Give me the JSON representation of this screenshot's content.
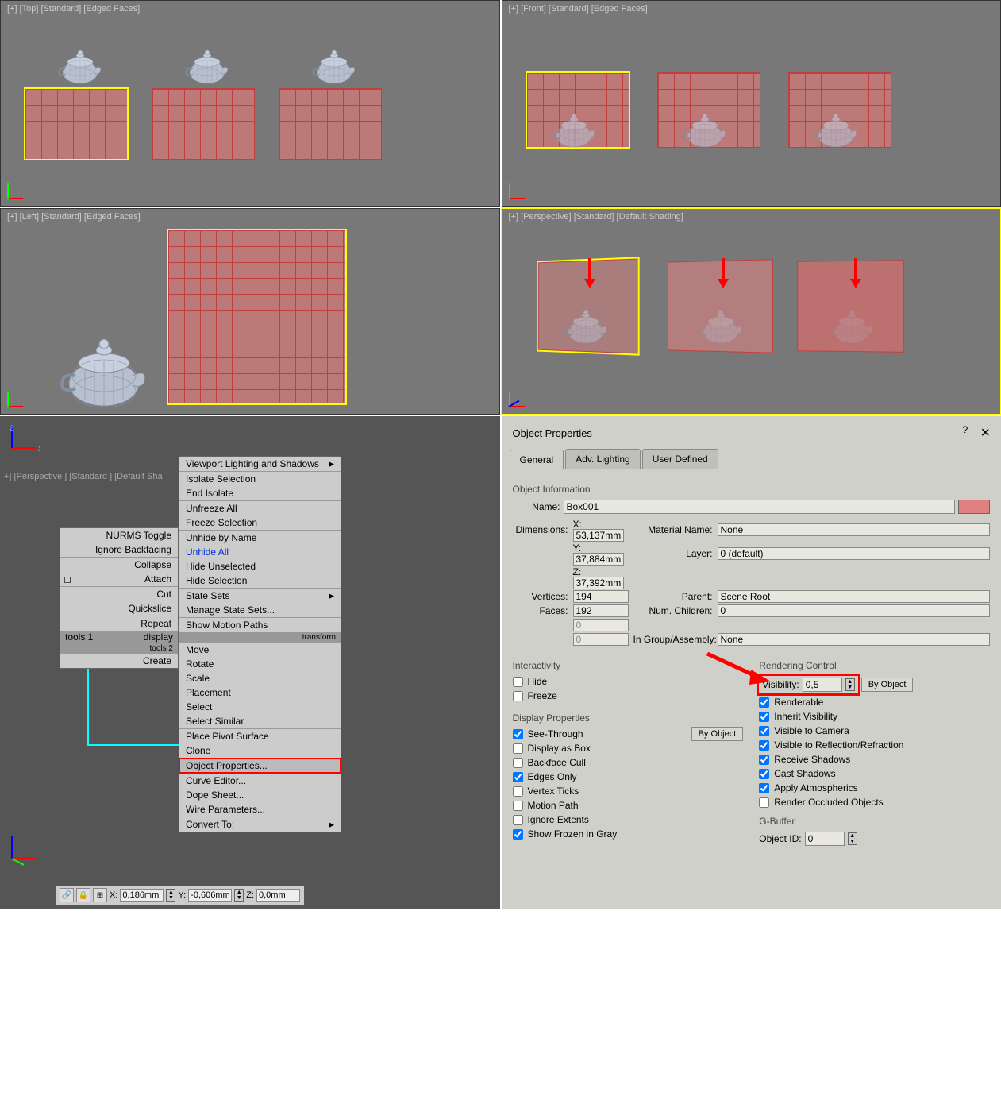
{
  "viewports": {
    "top": {
      "label": "[+] [Top] [Standard] [Edged Faces]"
    },
    "front": {
      "label": "[+] [Front] [Standard] [Edged Faces]"
    },
    "left": {
      "label": "[+] [Left] [Standard] [Edged Faces]"
    },
    "persp": {
      "label": "[+] [Perspective] [Standard] [Default Shading]"
    }
  },
  "context_bg_label": "+] [Perspective ] [Standard ] [Default Sha",
  "menu_cols": {
    "col1": {
      "items": [
        "NURMS Toggle",
        "Ignore Backfacing",
        "Collapse",
        "Attach",
        "Cut",
        "Quickslice",
        "Repeat"
      ],
      "footer_left": "tools 1",
      "sub_footer_left": "tools 2",
      "sub_item": "Create",
      "footer_right": "display"
    },
    "col2": {
      "items": [
        "Viewport Lighting and Shadows",
        "Isolate Selection",
        "End Isolate",
        "Unfreeze All",
        "Freeze Selection",
        "Unhide by Name",
        "Unhide All",
        "Hide Unselected",
        "Hide Selection",
        "State Sets",
        "Manage State Sets...",
        "Show Motion Paths"
      ],
      "blue_idx": 6,
      "footer_right": "transform",
      "transform_items": [
        "Move",
        "Rotate",
        "Scale",
        "Placement",
        "Select",
        "Select Similar",
        "Place Pivot Surface",
        "Clone",
        "Object Properties...",
        "Curve Editor...",
        "Dope Sheet...",
        "Wire Parameters...",
        "Convert To:"
      ],
      "highlighted_idx": 8
    }
  },
  "coords": {
    "x_label": "X:",
    "x": "0,186mm",
    "y_label": "Y:",
    "y": "-0,606mm",
    "z_label": "Z:",
    "z": "0,0mm"
  },
  "dialog": {
    "title": "Object Properties",
    "help": "?",
    "close": "×",
    "tabs": [
      "General",
      "Adv. Lighting",
      "User Defined"
    ],
    "info_header": "Object Information",
    "name_label": "Name:",
    "name_value": "Box001",
    "dims_label": "Dimensions:",
    "dims_x_label": "X:",
    "dims_x": "53,137mm",
    "dims_y_label": "Y:",
    "dims_y": "37,884mm",
    "dims_z_label": "Z:",
    "dims_z": "37,392mm",
    "mat_label": "Material Name:",
    "mat_val": "None",
    "layer_label": "Layer:",
    "layer_val": "0 (default)",
    "verts_label": "Vertices:",
    "verts_val": "194",
    "faces_label": "Faces:",
    "faces_val": "192",
    "parent_label": "Parent:",
    "parent_val": "Scene Root",
    "children_label": "Num. Children:",
    "children_val": "0",
    "group_label_full": "In Group/Assembly:",
    "group_val": "None",
    "zero": "0",
    "interactivity": {
      "header": "Interactivity",
      "hide": "Hide",
      "freeze": "Freeze"
    },
    "display_props": {
      "header": "Display Properties",
      "by_object": "By Object",
      "items": [
        "See-Through",
        "Display as Box",
        "Backface Cull",
        "Edges Only",
        "Vertex Ticks",
        "Motion Path",
        "Ignore Extents",
        "Show Frozen in Gray"
      ],
      "checked": [
        true,
        false,
        false,
        true,
        false,
        false,
        false,
        true
      ]
    },
    "rendering": {
      "header": "Rendering Control",
      "visibility_label": "Visibility:",
      "visibility_val": "0,5",
      "by_object": "By Object",
      "items": [
        "Renderable",
        "Inherit Visibility",
        "Visible to Camera",
        "Visible to Reflection/Refraction",
        "Receive Shadows",
        "Cast Shadows",
        "Apply Atmospherics",
        "Render Occluded Objects"
      ],
      "checked": [
        true,
        true,
        true,
        true,
        true,
        true,
        true,
        false
      ]
    },
    "gbuffer": {
      "header": "G-Buffer",
      "obj_id_label": "Object ID:",
      "obj_id_val": "0"
    }
  }
}
